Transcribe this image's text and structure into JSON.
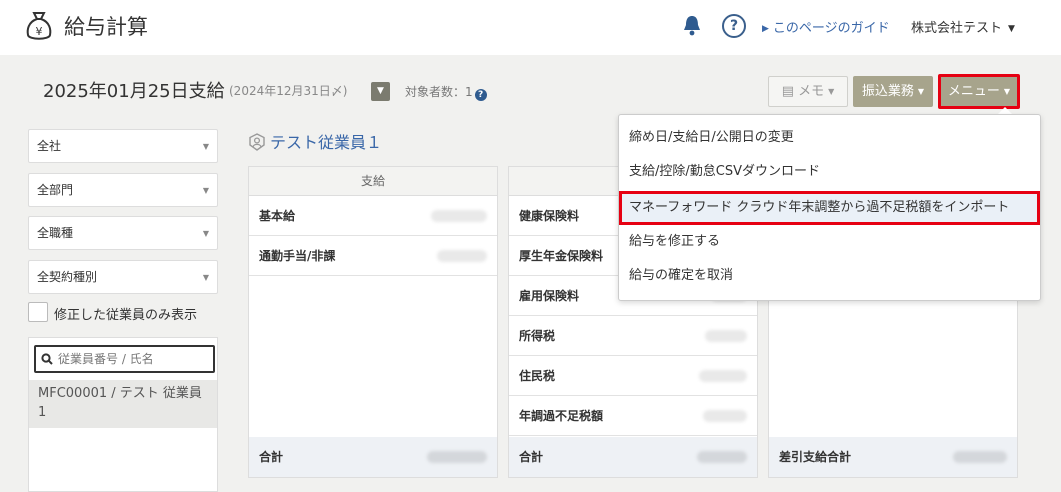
{
  "header": {
    "app_title": "給与計算",
    "guide_link": "このページのガイド",
    "company": "株式会社テスト"
  },
  "titlebar": {
    "title": "2025年01月25日支給",
    "subtitle": "(2024年12月31日〆)",
    "count_label": "対象者数：1",
    "memo_button": "メモ",
    "furikomi_button": "振込業務",
    "menu_button": "メニュー"
  },
  "sidebar": {
    "filters": [
      "全社",
      "全部門",
      "全職種",
      "全契約種別"
    ],
    "checkbox_label": "修正した従業員のみ表示",
    "search_placeholder": "従業員番号 / 氏名",
    "employees": [
      {
        "line1": "MFC00001 / テスト 従業員",
        "line2": "1"
      }
    ]
  },
  "main": {
    "employee_name": "テスト従業員１",
    "payments": {
      "header": "支給",
      "rows": [
        "基本給",
        "通勤手当/非課"
      ],
      "total_label": "合計"
    },
    "deductions": {
      "rows": [
        "健康保険料",
        "厚生年金保険料",
        "雇用保険料",
        "所得税",
        "住民税",
        "年調過不足税額"
      ],
      "total_label": "合計"
    },
    "net": {
      "total_label": "差引支給合計"
    }
  },
  "menu": {
    "items": [
      "締め日/支給日/公開日の変更",
      "支給/控除/勤怠CSVダウンロード",
      "マネーフォワード クラウド年末調整から過不足税額をインポート",
      "給与を修正する",
      "給与の確定を取消"
    ],
    "highlighted_index": 2
  },
  "colors": {
    "accent_blue": "#3a67a8",
    "button_olive": "#a7a48c",
    "highlight_red": "#e60012"
  }
}
